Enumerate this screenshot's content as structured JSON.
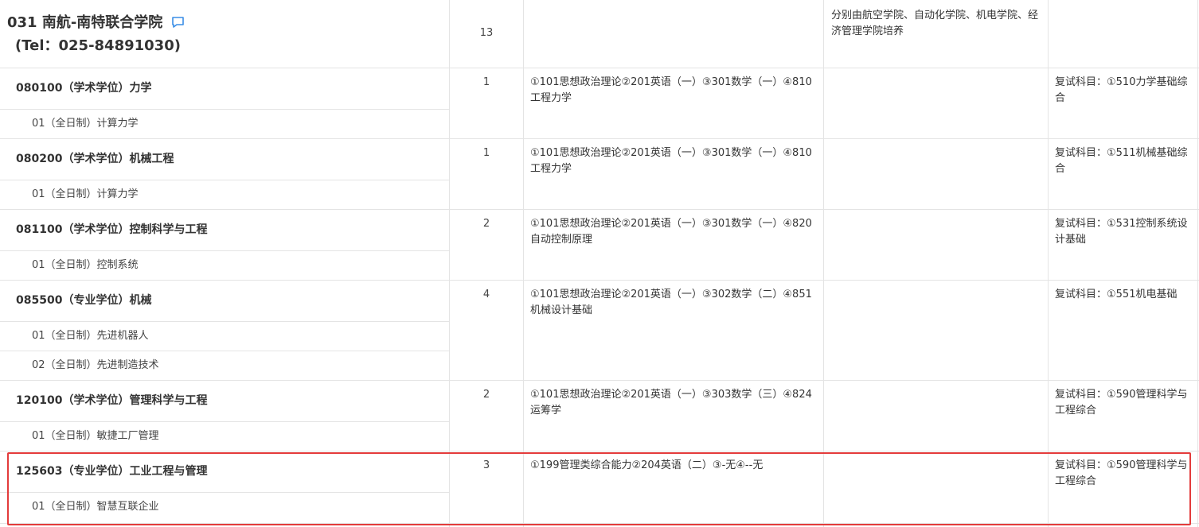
{
  "college": {
    "name": "031 南航-南特联合学院",
    "tel": "(Tel：025-84891030)",
    "total": "13",
    "note": "分别由航空学院、自动化学院、机电学院、经济管理学院培养"
  },
  "programs": [
    {
      "major": "080100（学术学位）力学",
      "directions": [
        "01（全日制）计算力学"
      ],
      "count": "1",
      "exam": "①101思想政治理论②201英语（一）③301数学（一）④810工程力学",
      "retest": "复试科目：①510力学基础综合"
    },
    {
      "major": "080200（学术学位）机械工程",
      "directions": [
        "01（全日制）计算力学"
      ],
      "count": "1",
      "exam": "①101思想政治理论②201英语（一）③301数学（一）④810工程力学",
      "retest": "复试科目：①511机械基础综合"
    },
    {
      "major": "081100（学术学位）控制科学与工程",
      "directions": [
        "01（全日制）控制系统"
      ],
      "count": "2",
      "exam": "①101思想政治理论②201英语（一）③301数学（一）④820自动控制原理",
      "retest": "复试科目：①531控制系统设计基础"
    },
    {
      "major": "085500（专业学位）机械",
      "directions": [
        "01（全日制）先进机器人",
        "02（全日制）先进制造技术"
      ],
      "count": "4",
      "exam": "①101思想政治理论②201英语（一）③302数学（二）④851机械设计基础",
      "retest": "复试科目：①551机电基础"
    },
    {
      "major": "120100（学术学位）管理科学与工程",
      "directions": [
        "01（全日制）敏捷工厂管理"
      ],
      "count": "2",
      "exam": "①101思想政治理论②201英语（一）③303数学（三）④824运筹学",
      "retest": "复试科目：①590管理科学与工程综合"
    },
    {
      "major": "125603（专业学位）工业工程与管理",
      "directions": [
        "01（全日制）智慧互联企业"
      ],
      "count": "3",
      "exam": "①199管理类综合能力②204英语（二）③-无④--无",
      "retest": "复试科目：①590管理科学与工程综合"
    }
  ],
  "icons": {
    "comment": "comment-icon"
  },
  "colors": {
    "highlight": "#e33b3b",
    "grid": "#e4e4e4",
    "icon": "#3a8ee6"
  }
}
